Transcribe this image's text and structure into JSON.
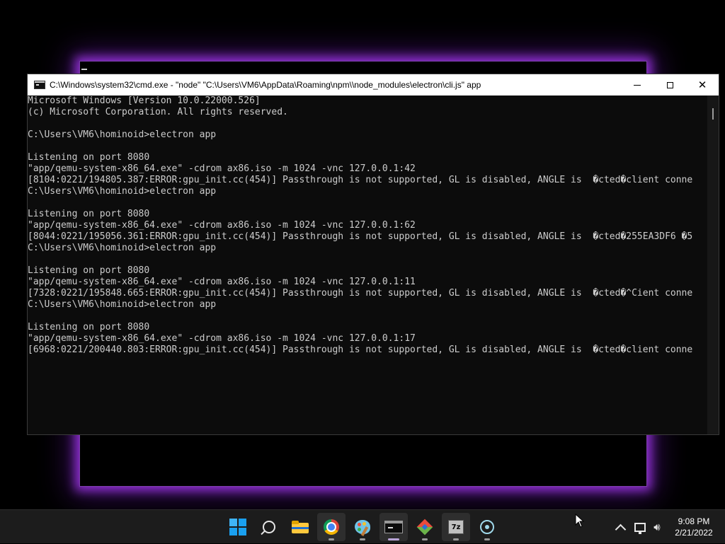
{
  "cmd_window": {
    "title": "C:\\Windows\\system32\\cmd.exe - \"node\"  \"C:\\Users\\VM6\\AppData\\Roaming\\npm\\\\node_modules\\electron\\cli.js\" app",
    "minimize_label": "",
    "maximize_label": "",
    "close_label": "✕",
    "lines": [
      "Microsoft Windows [Version 10.0.22000.526]",
      "(c) Microsoft Corporation. All rights reserved.",
      "",
      "C:\\Users\\VM6\\hominoid>electron app",
      "",
      "Listening on port 8080",
      "\"app/qemu-system-x86_64.exe\" -cdrom ax86.iso -m 1024 -vnc 127.0.0.1:42",
      "[8104:0221/194805.387:ERROR:gpu_init.cc(454)] Passthrough is not supported, GL is disabled, ANGLE is  �cted�client conne",
      "C:\\Users\\VM6\\hominoid>electron app",
      "",
      "Listening on port 8080",
      "\"app/qemu-system-x86_64.exe\" -cdrom ax86.iso -m 1024 -vnc 127.0.0.1:62",
      "[8044:0221/195056.361:ERROR:gpu_init.cc(454)] Passthrough is not supported, GL is disabled, ANGLE is  �cted�255EA3DF6 �5",
      "C:\\Users\\VM6\\hominoid>electron app",
      "",
      "Listening on port 8080",
      "\"app/qemu-system-x86_64.exe\" -cdrom ax86.iso -m 1024 -vnc 127.0.0.1:11",
      "[7328:0221/195848.665:ERROR:gpu_init.cc(454)] Passthrough is not supported, GL is disabled, ANGLE is  �cted�^Cient conne",
      "C:\\Users\\VM6\\hominoid>electron app",
      "",
      "Listening on port 8080",
      "\"app/qemu-system-x86_64.exe\" -cdrom ax86.iso -m 1024 -vnc 127.0.0.1:17",
      "[6968:0221/200440.803:ERROR:gpu_init.cc(454)] Passthrough is not supported, GL is disabled, ANGLE is  �cted�client conne"
    ]
  },
  "taskbar": {
    "icons": [
      {
        "name": "start-icon",
        "active": false,
        "running": false
      },
      {
        "name": "search-icon",
        "active": false,
        "running": false
      },
      {
        "name": "file-explorer-icon",
        "active": false,
        "running": false
      },
      {
        "name": "chrome-icon",
        "active": true,
        "running": true
      },
      {
        "name": "paint-icon",
        "active": false,
        "running": true
      },
      {
        "name": "command-prompt-icon",
        "active": true,
        "running": true
      },
      {
        "name": "git-icon",
        "active": false,
        "running": true
      },
      {
        "name": "7zip-icon",
        "active": true,
        "running": true
      },
      {
        "name": "electron-icon",
        "active": false,
        "running": true
      }
    ],
    "tray": {
      "overflow_icon": "chevron-up-icon",
      "network_icon": "network-icon",
      "volume_icon": "volume-icon"
    },
    "clock": {
      "time": "9:08 PM",
      "date": "2/21/2022"
    }
  },
  "colors": {
    "glow": "#b03cff",
    "console_text": "#cccccc",
    "console_bg": "#0c0c0c",
    "taskbar_bg": "#1c1c1c"
  }
}
